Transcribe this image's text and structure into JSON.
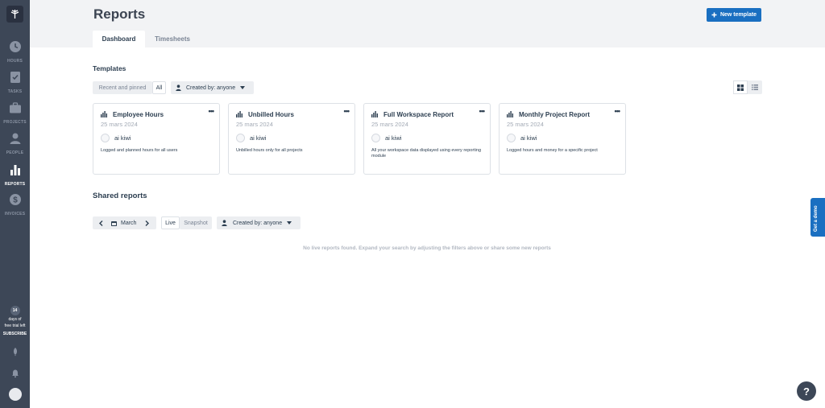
{
  "sidebar": {
    "items": [
      {
        "label": "HOURS",
        "icon": "clock-icon"
      },
      {
        "label": "TASKS",
        "icon": "checklist-icon"
      },
      {
        "label": "PROJECTS",
        "icon": "briefcase-icon"
      },
      {
        "label": "PEOPLE",
        "icon": "person-icon"
      },
      {
        "label": "REPORTS",
        "icon": "bar-chart-icon"
      },
      {
        "label": "INVOICES",
        "icon": "dollar-icon"
      }
    ],
    "trial": {
      "days": "14",
      "line1": "days of",
      "line2": "free trial left",
      "subscribe": "SUBSCRIBE"
    }
  },
  "header": {
    "title": "Reports",
    "new_template": "New template",
    "tabs": [
      "Dashboard",
      "Timesheets"
    ]
  },
  "templates": {
    "title": "Templates",
    "filter_recent": "Recent and pinned",
    "filter_all": "All",
    "created_by": "Created by: anyone",
    "cards": [
      {
        "title": "Employee Hours",
        "date": "25 mars 2024",
        "owner": "ai kiwi",
        "desc": "Logged and planned hours for all users"
      },
      {
        "title": "Unbilled Hours",
        "date": "25 mars 2024",
        "owner": "ai kiwi",
        "desc": "Unbilled hours only for all projects"
      },
      {
        "title": "Full Workspace Report",
        "date": "25 mars 2024",
        "owner": "ai kiwi",
        "desc": "All your workspace data displayed using every reporting module"
      },
      {
        "title": "Monthly Project Report",
        "date": "25 mars 2024",
        "owner": "ai kiwi",
        "desc": "Logged hours and money for a specific project"
      }
    ]
  },
  "shared": {
    "title": "Shared reports",
    "month": "March",
    "live": "Live",
    "snapshot": "Snapshot",
    "created_by": "Created by: anyone",
    "empty": "No live reports found. Expand your search by adjusting the filters above or share some new reports"
  },
  "demo_label": "Get a demo",
  "help_label": "?",
  "colors": {
    "sidebar": "#3d4757",
    "accent": "#1a6fc1",
    "header_bg": "#f2f3f5"
  }
}
